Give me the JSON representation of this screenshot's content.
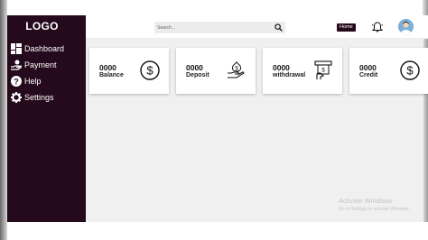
{
  "sidebar": {
    "logo": "LOGO",
    "items": [
      {
        "label": "Dashboard",
        "icon": "dashboard-icon"
      },
      {
        "label": "Payment",
        "icon": "payment-icon"
      },
      {
        "label": "Help",
        "icon": "help-icon"
      },
      {
        "label": "Settings",
        "icon": "gear-icon"
      }
    ]
  },
  "topbar": {
    "search_placeholder": "Search...",
    "home_label": "Home",
    "icons": [
      "search-icon",
      "bell-icon",
      "avatar"
    ]
  },
  "cards": [
    {
      "value": "0000",
      "label": "Balance",
      "icon": "dollar-circle-icon"
    },
    {
      "value": "0000",
      "label": "Deposit",
      "icon": "money-hand-icon"
    },
    {
      "value": "0000",
      "label": "withdrawal",
      "icon": "atm-withdrawal-icon"
    },
    {
      "value": "0000",
      "label": "Credit",
      "icon": "dollar-circle-icon"
    }
  ],
  "watermark": {
    "line1": "Activate Windows",
    "line2": "Go to Settings to activate Windows."
  },
  "colors": {
    "sidebar_bg": "#25091c",
    "main_bg": "#f0f0f0",
    "card_bg": "#ffffff",
    "home_button_bg": "#25091c"
  }
}
